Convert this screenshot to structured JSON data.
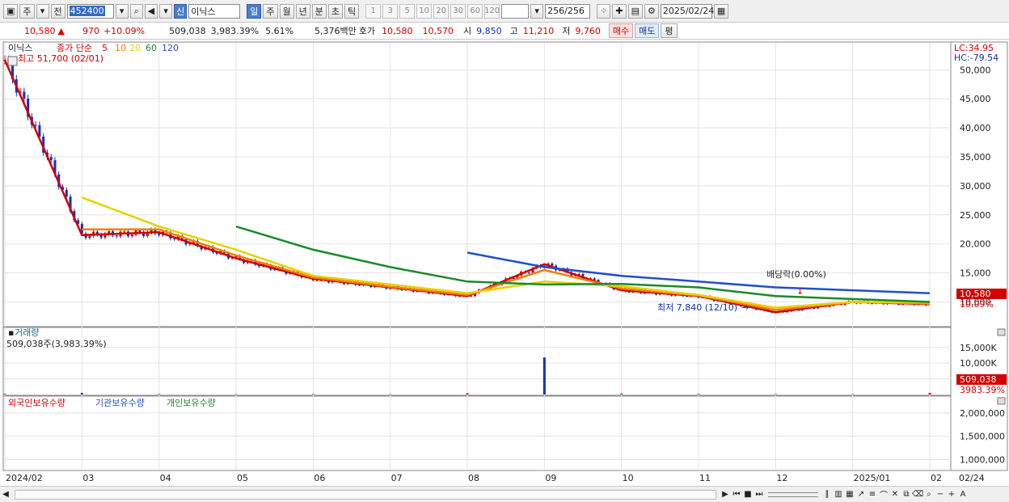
{
  "toolbar": {
    "period": "주",
    "prev_label": "전",
    "code": "452400",
    "new_badge": "신",
    "stock_name": "이닉스",
    "intervals": [
      "일",
      "주",
      "월",
      "년",
      "분",
      "초",
      "틱"
    ],
    "active_interval": "일",
    "numbers": [
      "1",
      "3",
      "5",
      "10",
      "20",
      "30",
      "60",
      "120"
    ],
    "count": "256",
    "count_total": "/256",
    "date": "2025/02/24"
  },
  "quote": {
    "price": "10,580",
    "change": "970",
    "change_pct": "+10.09%",
    "volume": "509,038",
    "volume_ratio": "3,983.39%",
    "turnover_pct": "5.61%",
    "amount": "5,376백만",
    "hoga_label": "호가",
    "ask": "10,580",
    "bid": "10,570",
    "open_label": "시",
    "open": "9,850",
    "high_label": "고",
    "high": "11,210",
    "low_label": "저",
    "low": "9,760",
    "buy_button": "매수",
    "sell_button": "매도",
    "eval_button": "평"
  },
  "price_panel": {
    "stock_tag": "이닉스",
    "ma_title": "종가 단순",
    "ma_periods": [
      {
        "label": "5",
        "color": "#d40000"
      },
      {
        "label": "10",
        "color": "#f08000"
      },
      {
        "label": "20",
        "color": "#e8d000"
      },
      {
        "label": "60",
        "color": "#1a8a2a"
      },
      {
        "label": "120",
        "color": "#2050c8"
      }
    ],
    "high_note": "최고 51,700 (02/01)",
    "low_note": "최저 7,840 (12/10)",
    "dividend_note": "배당락(0.00%)",
    "lc": "LC:34.95",
    "hc": "HC:-79.54",
    "price_tag": "10,580",
    "pct_tag": "10.09%",
    "y_ticks": [
      "50,000",
      "45,000",
      "40,000",
      "35,000",
      "30,000",
      "25,000",
      "20,000",
      "15,000",
      "10,000"
    ]
  },
  "volume_panel": {
    "title": "거래량",
    "value_label": "509,038주(3,983.39%)",
    "y_ticks": [
      "15,000K",
      "10,000K",
      "5,000K"
    ],
    "tag_value": "509,038",
    "tag_pct": "3983.39%"
  },
  "holdings_panel": {
    "legend": [
      {
        "label": "외국인보유수량",
        "color": "#d40000"
      },
      {
        "label": "기관보유수량",
        "color": "#2050c8"
      },
      {
        "label": "개인보유수량",
        "color": "#1a8a2a"
      }
    ],
    "y_ticks": [
      "2,000,000",
      "1,500,000",
      "1,000,000"
    ]
  },
  "x_axis": {
    "labels": [
      "2024/02",
      "03",
      "04",
      "05",
      "06",
      "07",
      "08",
      "09",
      "10",
      "11",
      "12",
      "2025/01",
      "02"
    ],
    "current_date": "02/24"
  },
  "chart_data": {
    "type": "line",
    "title": "이닉스",
    "x": [
      "2024/02",
      "03",
      "04",
      "05",
      "06",
      "07",
      "08",
      "09",
      "10",
      "11",
      "12",
      "2025/01",
      "02"
    ],
    "series": [
      {
        "name": "5",
        "values": [
          51700,
          21500,
          22000,
          17500,
          14000,
          12500,
          11000,
          16500,
          12000,
          11000,
          8200,
          10000,
          9600
        ]
      },
      {
        "name": "10",
        "values": [
          null,
          22500,
          22500,
          18000,
          14200,
          12600,
          11200,
          15500,
          12300,
          11100,
          8600,
          10000,
          9700
        ]
      },
      {
        "name": "20",
        "values": [
          null,
          28000,
          23000,
          19000,
          14500,
          13000,
          11500,
          13500,
          12700,
          11200,
          9000,
          10000,
          9900
        ]
      },
      {
        "name": "60",
        "values": [
          null,
          null,
          null,
          23000,
          19000,
          16000,
          13500,
          13000,
          13100,
          12500,
          11000,
          10500,
          10000
        ]
      },
      {
        "name": "120",
        "values": [
          null,
          null,
          null,
          null,
          null,
          null,
          18500,
          16000,
          14500,
          13500,
          12500,
          12000,
          11500
        ]
      }
    ],
    "volume_k": [
      200,
      500,
      150,
      100,
      150,
      100,
      400,
      11800,
      300,
      200,
      150,
      100,
      509
    ],
    "ylim": [
      7000,
      52000
    ]
  }
}
